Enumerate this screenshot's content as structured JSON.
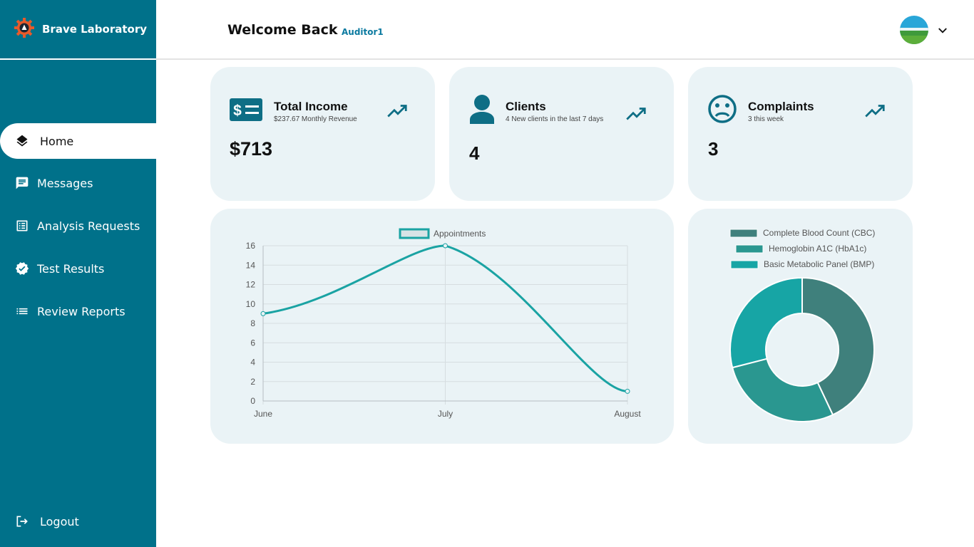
{
  "app": {
    "name": "Brave Laboratory"
  },
  "header": {
    "welcome": "Welcome Back",
    "user": "Auditor1"
  },
  "sidebar": {
    "items": [
      {
        "label": "Home",
        "icon": "layers-icon",
        "active": true
      },
      {
        "label": "Messages",
        "icon": "message-icon"
      },
      {
        "label": "Analysis Requests",
        "icon": "list-alt-icon"
      },
      {
        "label": "Test Results",
        "icon": "verified-icon"
      },
      {
        "label": "Review Reports",
        "icon": "list-icon"
      }
    ],
    "logout": "Logout"
  },
  "stats": [
    {
      "title": "Total Income",
      "subtitle": "$237.67 Monthly Revenue",
      "value": "$713",
      "icon": "money-icon"
    },
    {
      "title": "Clients",
      "subtitle": "4 New clients in the last 7 days",
      "value": "4",
      "icon": "person-icon"
    },
    {
      "title": "Complaints",
      "subtitle": "3 this week",
      "value": "3",
      "icon": "sad-face-icon"
    }
  ],
  "colors": {
    "primary": "#00718a",
    "card": "#eaf3f6",
    "line": "#1aa3a3",
    "trend": "#0e6e85"
  },
  "chart_data": [
    {
      "type": "line",
      "x": [
        "June",
        "July",
        "August"
      ],
      "series": [
        {
          "name": "Appointments",
          "values": [
            9,
            16,
            1
          ]
        }
      ],
      "ylim": [
        0,
        16
      ],
      "yticks": [
        0,
        2,
        4,
        6,
        8,
        10,
        12,
        14,
        16
      ],
      "grid": true,
      "legend": "top"
    },
    {
      "type": "pie",
      "labels": [
        "Complete Blood Count (CBC)",
        "Hemoglobin A1C (HbA1c)",
        "Basic Metabolic Panel (BMP)"
      ],
      "values": [
        43,
        28,
        29
      ],
      "colors": [
        "#3f807c",
        "#2a9790",
        "#17a5a5"
      ],
      "legend": "top"
    }
  ]
}
